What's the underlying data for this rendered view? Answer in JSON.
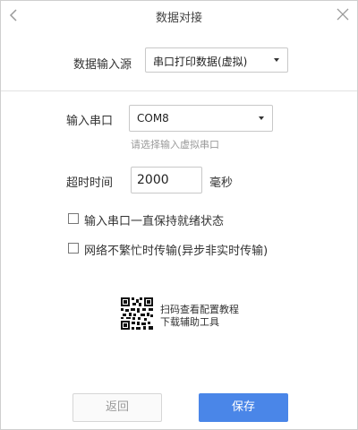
{
  "title": "数据对接",
  "source": {
    "label": "数据输入源",
    "value": "串口打印数据(虚拟)"
  },
  "port": {
    "label": "输入串口",
    "value": "COM8",
    "hint": "请选择输入虚拟串口"
  },
  "timeout": {
    "label": "超时时间",
    "value": "2000",
    "unit": "毫秒"
  },
  "options": [
    {
      "label": "输入串口一直保持就绪状态",
      "checked": false
    },
    {
      "label": "网络不繁忙时传输(异步非实时传输)",
      "checked": false
    }
  ],
  "qr": {
    "line1": "扫码查看配置教程",
    "line2": "下载辅助工具"
  },
  "buttons": {
    "back": "返回",
    "save": "保存"
  },
  "colors": {
    "primary": "#4a86e8",
    "hint": "#9a9a9a"
  }
}
